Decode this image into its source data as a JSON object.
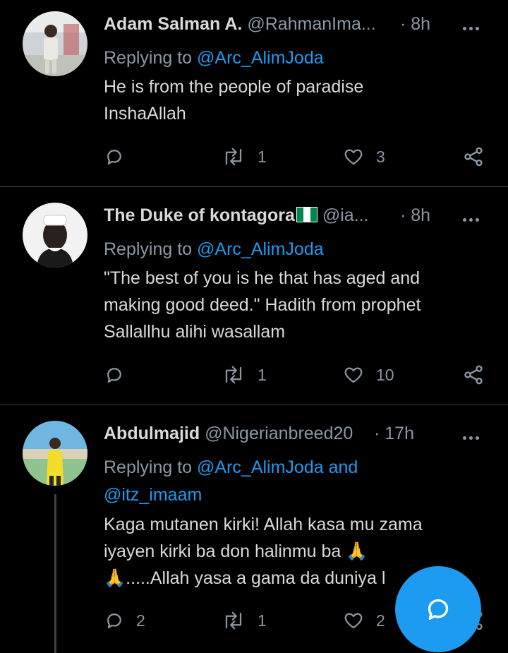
{
  "tweets": [
    {
      "display_name": "Adam Salman A.",
      "handle": "@RahmanIma...",
      "time": "· 8h",
      "replying_prefix": "Replying to ",
      "replying_to": "@Arc_AlimJoda",
      "text_lines": [
        "He is from the people of paradise",
        "InshaAllah"
      ],
      "reply_count": "",
      "retweet_count": "1",
      "like_count": "3"
    },
    {
      "display_name": "The Duke of kontagora",
      "handle": "@ia...",
      "time": "· 8h",
      "replying_prefix": "Replying to ",
      "replying_to": "@Arc_AlimJoda",
      "text_lines": [
        "\"The best of you is he that has aged and",
        "making good deed.\" Hadith from prophet",
        "Sallallhu alihi wasallam"
      ],
      "reply_count": "",
      "retweet_count": "1",
      "like_count": "10"
    },
    {
      "display_name": "Abdulmajid",
      "handle": "@Nigerianbreed20",
      "time": "· 17h",
      "replying_prefix": "Replying to ",
      "replying_to": "@Arc_AlimJoda and",
      "replying_to_2": "@itz_imaam",
      "text_lines": [
        "Kaga mutanen kirki! Allah kasa mu zama",
        "iyayen kirki ba don halinmu ba",
        ".....Allah yasa a gama da duniya l"
      ],
      "reply_count": "2",
      "retweet_count": "1",
      "like_count": "2"
    }
  ],
  "icons": {
    "reply": "reply-icon",
    "retweet": "retweet-icon",
    "like": "heart-icon",
    "share": "share-icon",
    "more": "more-options-icon",
    "compose": "compose-reply-icon"
  },
  "colors": {
    "accent": "#1d9bf0",
    "background": "#000000",
    "muted": "#8b98a5",
    "divider": "#38444d"
  }
}
